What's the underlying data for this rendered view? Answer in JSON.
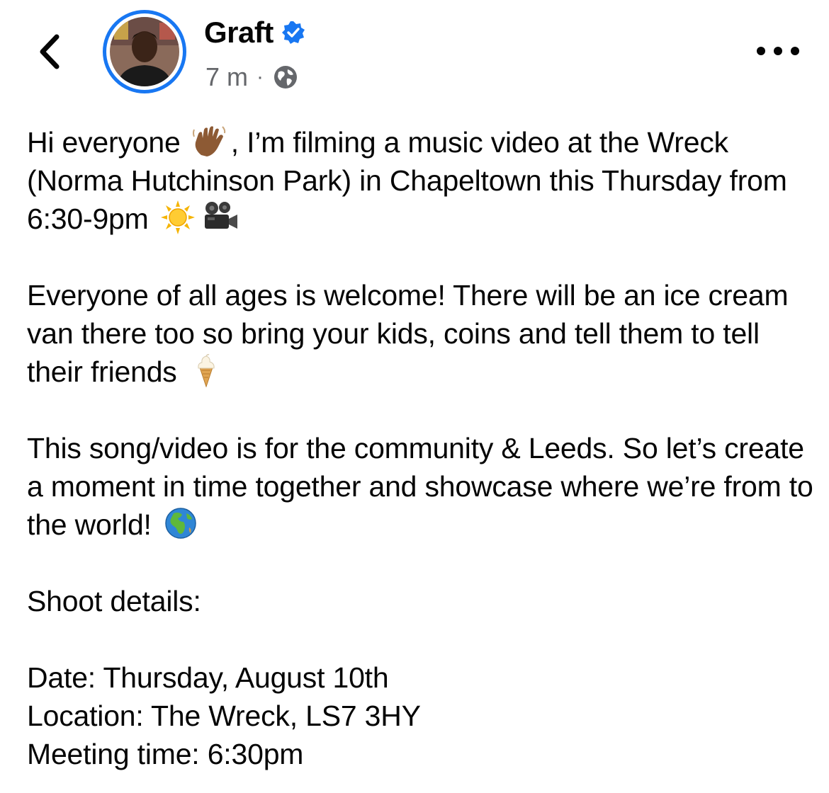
{
  "post": {
    "author": "Graft",
    "time": "7 m",
    "separator": "·",
    "paragraphs": {
      "p1": {
        "a": "Hi everyone",
        "b": ", I’m filming a music video at the Wreck (Norma Hutchinson Park) in Chapeltown this Thursday from 6:30-9pm"
      },
      "p2": {
        "a": "Everyone of all ages is welcome! There will be an ice cream van there too so bring your kids, coins and tell them to tell their friends"
      },
      "p3": {
        "a": "This song/video is for the community & Leeds. So let’s create a moment in time together and showcase where we’re from to the world!"
      },
      "p4": {
        "a": "Shoot details:"
      }
    },
    "details": {
      "date": "Date: Thursday, August 10th",
      "location": "Location: The Wreck, LS7 3HY",
      "meeting": "Meeting time: 6:30pm"
    }
  },
  "icons": {
    "back": "chevron-left-icon",
    "verified": "verified-badge-icon",
    "privacy": "globe-icon",
    "more": "more-options-icon",
    "emojis": [
      "waving-hand-icon",
      "sun-icon",
      "movie-camera-icon",
      "ice-cream-icon",
      "earth-globe-icon"
    ]
  },
  "colors": {
    "accent": "#1877f2",
    "text": "#050505",
    "meta": "#65676b"
  }
}
